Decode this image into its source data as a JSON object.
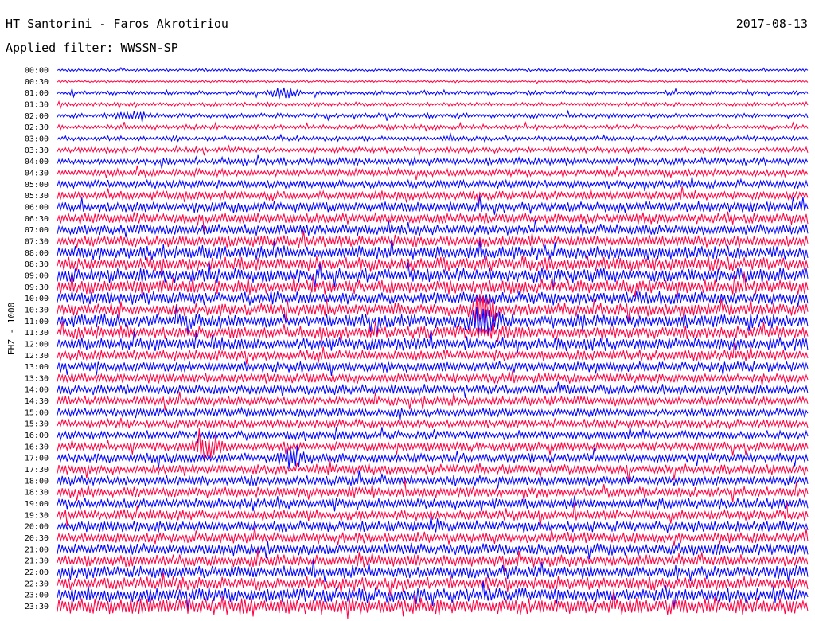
{
  "header": {
    "station": "HT Santorini - Faros Akrotiriou",
    "date": "2017-08-13",
    "filter": "Applied filter: WWSSN-SP"
  },
  "channel_label": "EHZ - 1000",
  "colors": {
    "even_trace": "#0000ff",
    "odd_trace": "#ff0040",
    "background": "#ffffff"
  },
  "chart_data": {
    "type": "line",
    "title": "HT Santorini - Faros Akrotiriou",
    "subtitle": "Applied filter: WWSSN-SP",
    "ylabel": "EHZ - 1000",
    "y_tick_labels": [
      "00:00",
      "00:30",
      "01:00",
      "01:30",
      "02:00",
      "02:30",
      "03:00",
      "03:30",
      "04:00",
      "04:30",
      "05:00",
      "05:30",
      "06:00",
      "06:30",
      "07:00",
      "07:30",
      "08:00",
      "08:30",
      "09:00",
      "09:30",
      "10:00",
      "10:30",
      "11:00",
      "11:30",
      "12:00",
      "12:30",
      "13:00",
      "13:30",
      "14:00",
      "14:30",
      "15:00",
      "15:30",
      "16:00",
      "16:30",
      "17:00",
      "17:30",
      "18:00",
      "18:30",
      "19:00",
      "19:30",
      "20:00",
      "20:30",
      "21:00",
      "21:30",
      "22:00",
      "22:30",
      "23:00",
      "23:30"
    ],
    "trace_minutes": 30,
    "series_colors": [
      "#0000ff",
      "#ff0040"
    ],
    "relative_amplitude": [
      0.6,
      0.5,
      0.9,
      0.9,
      1.1,
      1.1,
      1.1,
      1.3,
      1.6,
      1.7,
      1.9,
      2.0,
      2.5,
      2.5,
      2.6,
      2.7,
      3.2,
      3.2,
      3.3,
      3.3,
      3.0,
      3.0,
      3.2,
      3.0,
      3.1,
      2.6,
      2.5,
      2.3,
      2.3,
      2.2,
      2.1,
      2.0,
      2.0,
      2.1,
      2.2,
      2.3,
      2.4,
      2.4,
      2.5,
      2.5,
      2.6,
      2.6,
      2.7,
      2.8,
      2.9,
      3.0,
      3.3,
      3.8
    ],
    "events": [
      {
        "trace": "01:00",
        "minute": 9,
        "amplitude": 2.2
      },
      {
        "trace": "02:00",
        "minute": 3,
        "amplitude": 2.0
      },
      {
        "trace": "10:30",
        "minute": 17,
        "amplitude": 6.0
      },
      {
        "trace": "11:00",
        "minute": 17,
        "amplitude": 5.5
      },
      {
        "trace": "16:30",
        "minute": 6,
        "amplitude": 5.0
      },
      {
        "trace": "17:00",
        "minute": 9.5,
        "amplitude": 3.5
      }
    ]
  }
}
